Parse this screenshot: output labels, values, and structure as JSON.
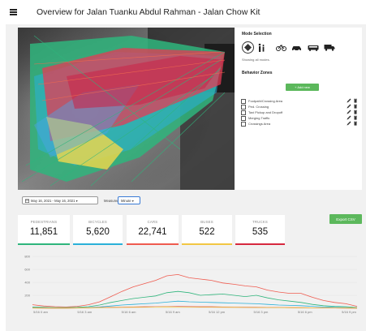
{
  "header": {
    "title": "Overview for Jalan Tuanku Abdul Rahman - Jalan Chow Kit"
  },
  "mode_selection": {
    "heading": "Mode Selection",
    "modes": [
      "all-modes",
      "pedestrian",
      "bicycle",
      "car",
      "bus",
      "truck"
    ],
    "status": "Showing all modes."
  },
  "behavior_zones": {
    "heading": "Behavior Zones",
    "add_label": "+ Add new",
    "zones": [
      {
        "label": "Footpath/Crossing Area"
      },
      {
        "label": "Ped. Crossing"
      },
      {
        "label": "Taxi Pickup and Dropoff"
      },
      {
        "label": "Merging Traffic"
      },
      {
        "label": "Crossings Area"
      }
    ]
  },
  "filters": {
    "date_range": "May 16, 2021 - May 16, 2021 ▾",
    "measured_by_label": "Measured By",
    "measured_by_value": "Minute ▾"
  },
  "export_label": "Export CSV",
  "stats": [
    {
      "label": "PEDESTRIANS",
      "value": "11,851",
      "color": "#2fb57c"
    },
    {
      "label": "BICYCLES",
      "value": "5,620",
      "color": "#2ab0d8"
    },
    {
      "label": "CARS",
      "value": "22,741",
      "color": "#ef5b4f"
    },
    {
      "label": "BUSES",
      "value": "522",
      "color": "#f2c744"
    },
    {
      "label": "TRUCKS",
      "value": "535",
      "color": "#d6283f"
    }
  ],
  "chart_data": {
    "type": "line",
    "ylim": [
      0,
      800
    ],
    "y_ticks": [
      "800",
      "600",
      "400",
      "200",
      ""
    ],
    "x_ticks": [
      "5/16 0 am",
      "5/16 3 am",
      "5/16 6 am",
      "5/16 9 am",
      "5/16 12 pm",
      "5/16 3 pm",
      "5/16 6 pm",
      "5/16 9 pm"
    ],
    "series": [
      {
        "color": "#ef5b4f",
        "values": [
          55,
          35,
          25,
          20,
          30,
          55,
          100,
          180,
          260,
          330,
          380,
          430,
          500,
          520,
          470,
          450,
          430,
          390,
          370,
          345,
          330,
          280,
          250,
          230,
          230,
          170,
          120,
          90,
          70,
          30
        ]
      },
      {
        "color": "#2fb57c",
        "values": [
          20,
          15,
          10,
          10,
          15,
          25,
          50,
          90,
          120,
          150,
          170,
          190,
          240,
          260,
          240,
          200,
          210,
          220,
          200,
          180,
          200,
          160,
          130,
          110,
          90,
          60,
          40,
          30,
          25,
          10
        ]
      },
      {
        "color": "#2ab0d8",
        "values": [
          10,
          8,
          5,
          5,
          8,
          10,
          20,
          35,
          50,
          60,
          70,
          80,
          95,
          110,
          100,
          95,
          90,
          85,
          80,
          75,
          70,
          60,
          50,
          45,
          40,
          30,
          20,
          15,
          10,
          5
        ]
      },
      {
        "color": "#d6283f",
        "values": [
          5,
          4,
          3,
          3,
          5,
          8,
          12,
          15,
          18,
          20,
          22,
          24,
          25,
          26,
          25,
          24,
          22,
          20,
          18,
          16,
          15,
          14,
          12,
          10,
          9,
          8,
          6,
          5,
          4,
          3
        ]
      },
      {
        "color": "#f2c744",
        "values": [
          4,
          3,
          3,
          3,
          4,
          6,
          10,
          12,
          14,
          16,
          18,
          20,
          22,
          20,
          19,
          18,
          17,
          16,
          15,
          14,
          13,
          12,
          11,
          10,
          9,
          8,
          6,
          5,
          4,
          3
        ]
      }
    ]
  }
}
